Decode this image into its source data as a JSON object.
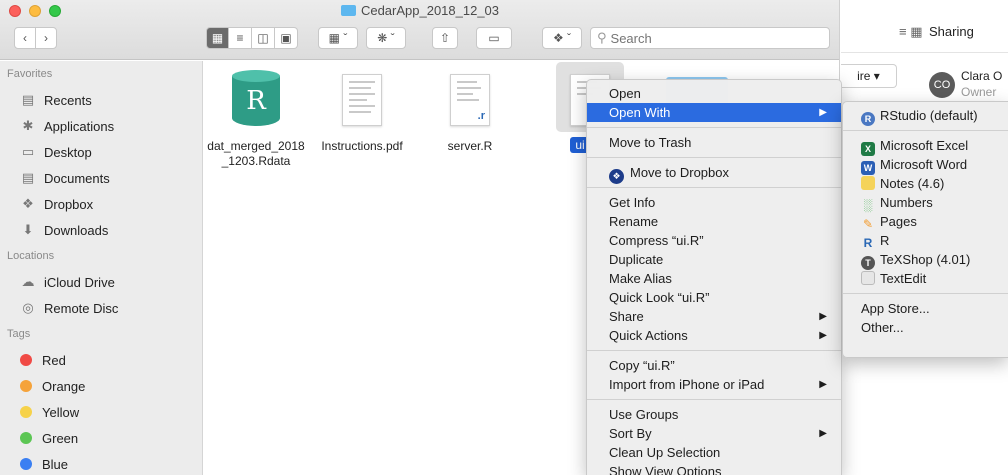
{
  "window": {
    "title": "CedarApp_2018_12_03",
    "search_placeholder": "Search"
  },
  "sidebar": {
    "favorites_header": "Favorites",
    "favorites": [
      {
        "label": "Recents",
        "icon": "recents-icon"
      },
      {
        "label": "Applications",
        "icon": "applications-icon"
      },
      {
        "label": "Desktop",
        "icon": "desktop-icon"
      },
      {
        "label": "Documents",
        "icon": "documents-icon"
      },
      {
        "label": "Dropbox",
        "icon": "dropbox-icon"
      },
      {
        "label": "Downloads",
        "icon": "downloads-icon"
      }
    ],
    "locations_header": "Locations",
    "locations": [
      {
        "label": "iCloud Drive",
        "icon": "cloud-icon"
      },
      {
        "label": "Remote Disc",
        "icon": "disc-icon"
      }
    ],
    "tags_header": "Tags",
    "tags": [
      {
        "label": "Red",
        "color": "#f04a45"
      },
      {
        "label": "Orange",
        "color": "#f5a33b"
      },
      {
        "label": "Yellow",
        "color": "#f6d24a"
      },
      {
        "label": "Green",
        "color": "#5cc654"
      },
      {
        "label": "Blue",
        "color": "#3a7ff2"
      }
    ]
  },
  "files": [
    {
      "name": "dat_merged_2018_1203.Rdata",
      "line1": "dat_merged_2018",
      "line2": "_1203.Rdata"
    },
    {
      "name": "Instructions.pdf"
    },
    {
      "name": "server.R"
    },
    {
      "name": "ui",
      "selected": true
    }
  ],
  "context_menu": {
    "open": "Open",
    "open_with": "Open With",
    "move_to_trash": "Move to Trash",
    "move_to_dropbox": "Move to Dropbox",
    "get_info": "Get Info",
    "rename": "Rename",
    "compress": "Compress “ui.R”",
    "duplicate": "Duplicate",
    "make_alias": "Make Alias",
    "quick_look": "Quick Look “ui.R”",
    "share": "Share",
    "quick_actions": "Quick Actions",
    "copy": "Copy “ui.R”",
    "import": "Import from iPhone or iPad",
    "use_groups": "Use Groups",
    "sort_by": "Sort By",
    "clean_up": "Clean Up Selection",
    "show_view_options": "Show View Options"
  },
  "open_with_menu": {
    "apps": [
      {
        "label": "RStudio (default)",
        "icon": "rstudio-icon",
        "color": "#4a78c2"
      },
      {
        "label": "Microsoft Excel",
        "icon": "excel-icon",
        "color": "#1f7a45"
      },
      {
        "label": "Microsoft Word",
        "icon": "word-icon",
        "color": "#2b5fb5"
      },
      {
        "label": "Notes (4.6)",
        "icon": "notes-icon",
        "color": "#f5d35a"
      },
      {
        "label": "Numbers",
        "icon": "numbers-icon",
        "color": "#3fae49"
      },
      {
        "label": "Pages",
        "icon": "pages-icon",
        "color": "#f39a2b"
      },
      {
        "label": "R",
        "icon": "r-icon",
        "color": "#2a68b5"
      },
      {
        "label": "TeXShop (4.01)",
        "icon": "texshop-icon",
        "color": "#555555"
      },
      {
        "label": "TextEdit",
        "icon": "textedit-icon",
        "color": "#cccccc"
      }
    ],
    "app_store": "App Store...",
    "other": "Other..."
  },
  "sharing_panel": {
    "title": "Sharing",
    "share_button": "ire ▾",
    "avatar_initials": "CO",
    "person_name": "Clara O",
    "person_role": "Owner"
  },
  "colors": {
    "selection": "#2b6be0",
    "accent": "#1f5fd4"
  }
}
